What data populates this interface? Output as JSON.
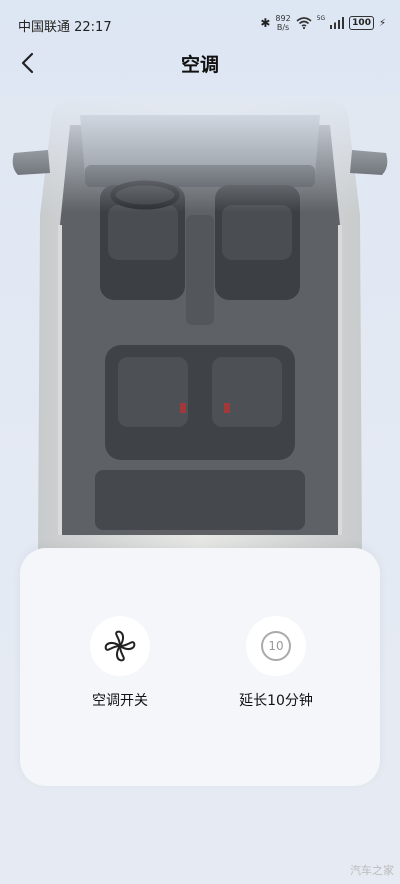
{
  "status_bar": {
    "carrier_time": "中国联通 22:17",
    "net_speed_value": "892",
    "net_speed_unit": "B/s",
    "signal_tag": "5G",
    "battery": "100"
  },
  "header": {
    "title": "空调"
  },
  "controls": [
    {
      "label": "空调开关",
      "icon": "fan-icon"
    },
    {
      "label": "延长10分钟",
      "icon": "extend-timer-icon",
      "badge": "10"
    }
  ],
  "watermark": "汽车之家"
}
